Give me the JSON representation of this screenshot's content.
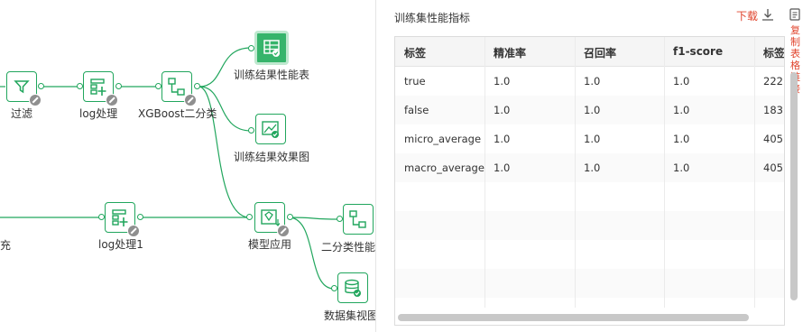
{
  "canvas": {
    "nodes": {
      "filter": {
        "label": "过滤",
        "icon": "filter-icon"
      },
      "log_process": {
        "label": "log处理",
        "icon": "add-table-icon"
      },
      "xgboost": {
        "label": "XGBoost二分类",
        "icon": "classifier-icon"
      },
      "train_perf_table": {
        "label": "训练结果性能表",
        "icon": "table-icon"
      },
      "train_effect_chart": {
        "label": "训练结果效果图",
        "icon": "image-chart-icon"
      },
      "fill": {
        "label": "充"
      },
      "log_process1": {
        "label": "log处理1",
        "icon": "add-table-icon"
      },
      "model_apply": {
        "label": "模型应用",
        "icon": "model-apply-icon"
      },
      "binary_perf": {
        "label": "二分类性能",
        "icon": "classifier-icon"
      },
      "dataset_view": {
        "label": "数据集视图",
        "icon": "database-icon"
      }
    },
    "accent": "#21a65d"
  },
  "panel": {
    "title": "训练集性能指标",
    "download_label": "下载",
    "copy_link_label": "复制表格链接",
    "table": {
      "columns": [
        "标签",
        "精准率",
        "召回率",
        "f1-score",
        "标签数"
      ],
      "rows": [
        [
          "true",
          "1.0",
          "1.0",
          "1.0",
          "222"
        ],
        [
          "false",
          "1.0",
          "1.0",
          "1.0",
          "183"
        ],
        [
          "micro_average",
          "1.0",
          "1.0",
          "1.0",
          "405"
        ],
        [
          "macro_average",
          "1.0",
          "1.0",
          "1.0",
          "405"
        ]
      ]
    }
  }
}
